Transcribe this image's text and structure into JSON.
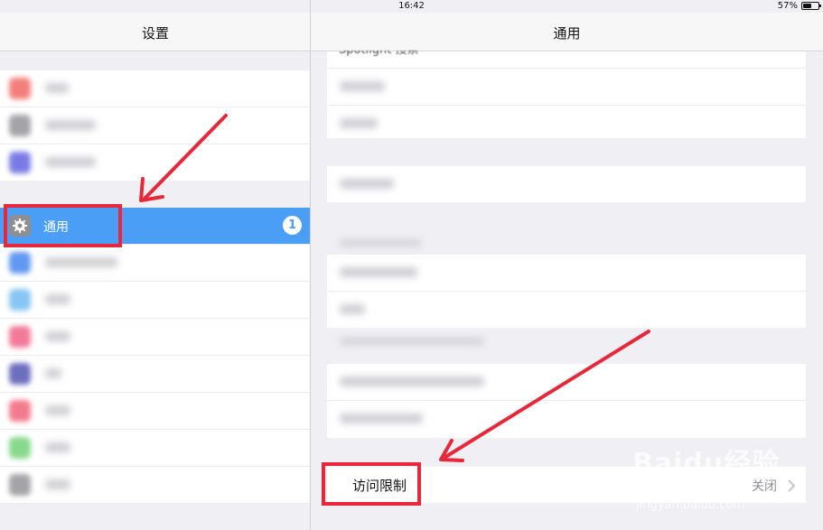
{
  "status_bar": {
    "device": "iPad",
    "time": "16:42",
    "battery_pct": "57%",
    "battery_level": 0.57
  },
  "left_panel": {
    "title": "设置",
    "selected_item": {
      "label": "通用",
      "badge": "1"
    }
  },
  "right_panel": {
    "title": "通用",
    "peek_row": "Spotlight 搜索",
    "restrictions": {
      "label": "访问限制",
      "value": "关闭"
    }
  },
  "watermark": {
    "brand": "Baidu经验",
    "url": "jingyan.baidu.com"
  },
  "colors": {
    "accent": "#4a9ef5",
    "annotation": "#e8283a"
  }
}
